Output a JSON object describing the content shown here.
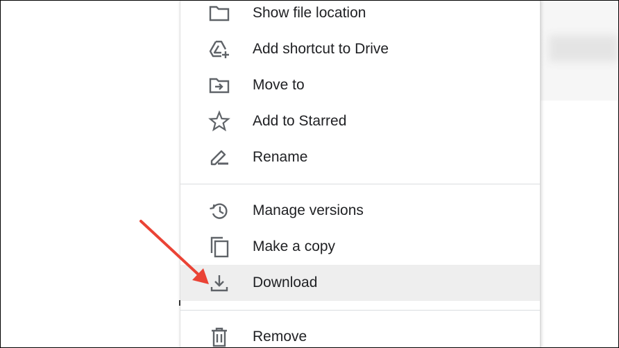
{
  "menu": {
    "items": [
      {
        "label": "Show file location",
        "icon": "folder-icon"
      },
      {
        "label": "Add shortcut to Drive",
        "icon": "add-shortcut-drive-icon"
      },
      {
        "label": "Move to",
        "icon": "move-to-folder-icon"
      },
      {
        "label": "Add to Starred",
        "icon": "star-icon"
      },
      {
        "label": "Rename",
        "icon": "pencil-icon"
      },
      {
        "label": "Manage versions",
        "icon": "history-icon"
      },
      {
        "label": "Make a copy",
        "icon": "copy-icon"
      },
      {
        "label": "Download",
        "icon": "download-icon",
        "highlighted": true
      },
      {
        "label": "Remove",
        "icon": "trash-icon"
      }
    ]
  },
  "colors": {
    "icon": "#5f6368",
    "text": "#202124",
    "highlight_bg": "#eeeeee",
    "divider": "#dadce0",
    "annotation_arrow": "#ea4335"
  }
}
